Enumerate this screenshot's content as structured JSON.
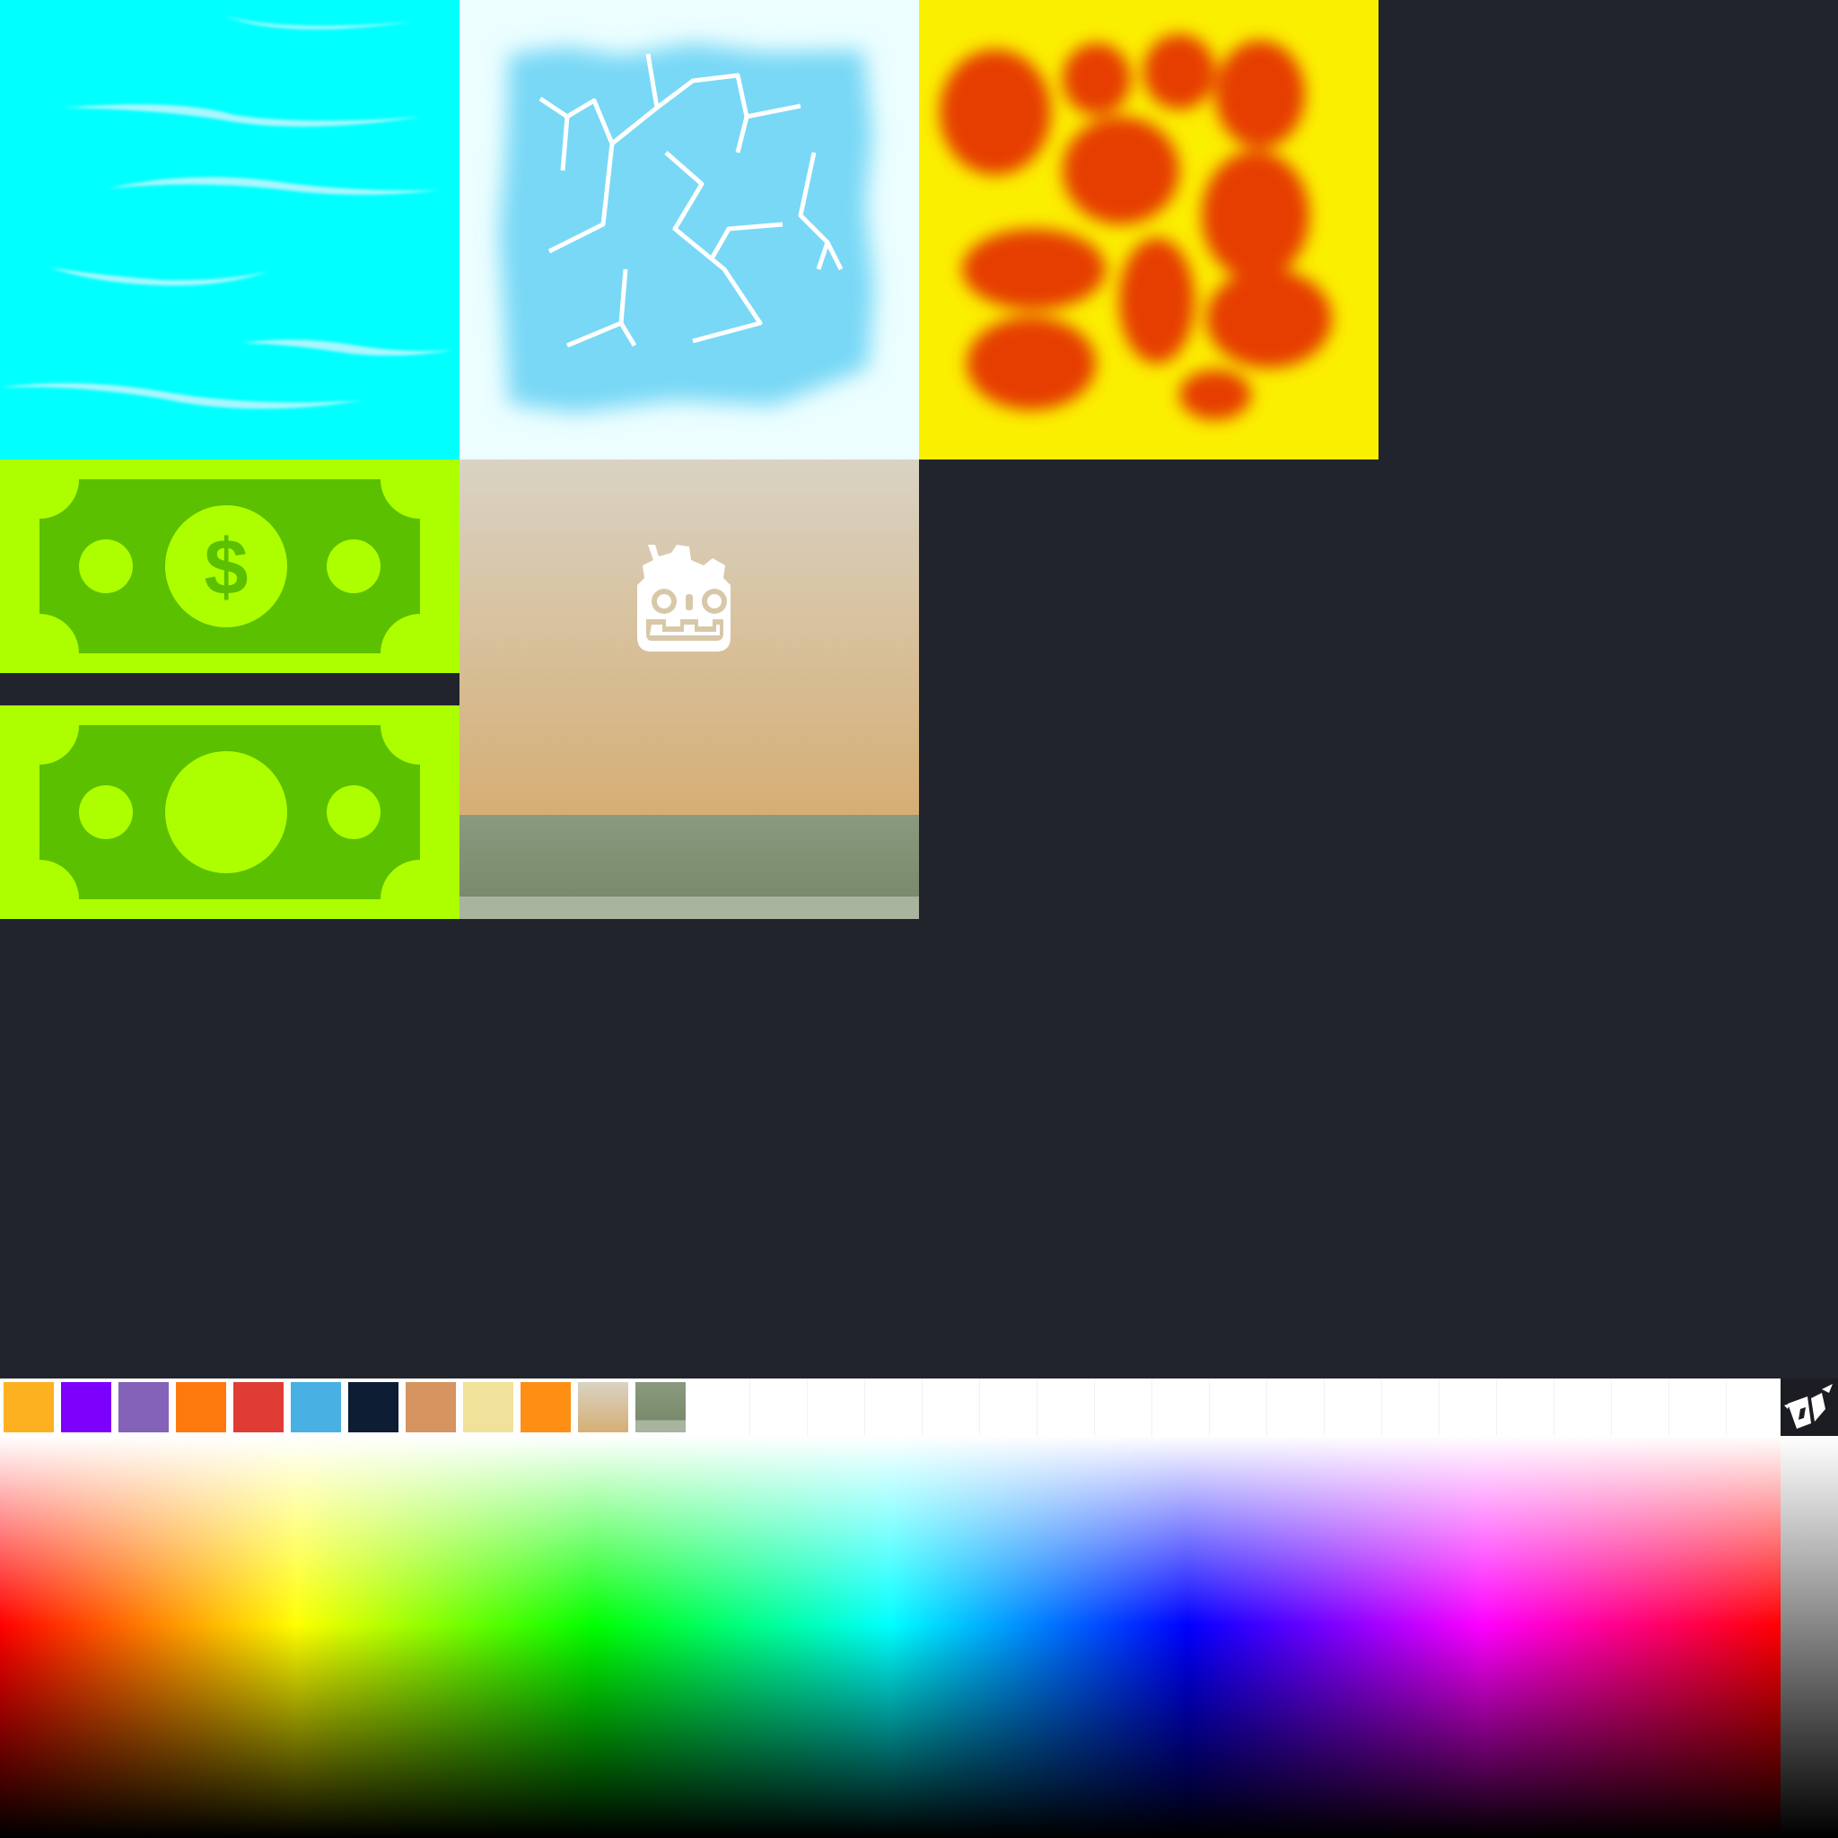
{
  "textures": [
    {
      "name": "water",
      "colors": {
        "base": "#00ffff",
        "wave": "#aaf6ff"
      }
    },
    {
      "name": "ice",
      "colors": {
        "base": "#ecfeff",
        "ice": "#78d8f6",
        "crack": "#ffffff"
      }
    },
    {
      "name": "lava",
      "colors": {
        "base": "#fbef00",
        "blob": "#e63d05"
      }
    },
    {
      "name": "banknote-dollar",
      "symbol": "$",
      "colors": {
        "bg": "#adff00",
        "note": "#5ac000"
      }
    },
    {
      "name": "banknote-blank",
      "colors": {
        "bg": "#adff00",
        "note": "#5ac000"
      }
    },
    {
      "name": "godot-sky",
      "icon": "godot-robot-icon",
      "colors": {
        "sky_top": "#d9d3c4",
        "sky_bottom": "#d6ae74",
        "ground": "#7d8c6f",
        "ground_strip": "#a8b49e"
      }
    }
  ],
  "palette": {
    "swatches": [
      {
        "color": "#fdb120"
      },
      {
        "color": "#7c00fc"
      },
      {
        "color": "#8462b7"
      },
      {
        "color": "#ff7a0e"
      },
      {
        "color": "#e03c36"
      },
      {
        "color": "#48b0e2"
      },
      {
        "color": "#0d1d33"
      },
      {
        "color": "#d59460"
      },
      {
        "color": "#f0e29a"
      },
      {
        "color": "#fe8f14"
      },
      {
        "color": "sky-gradient"
      },
      {
        "color": "ground-gradient"
      }
    ],
    "empty_slots": 19,
    "logo_icon": "origami-bird-logo-icon"
  },
  "spectrum": {
    "type": "hue-saturation-lightness"
  },
  "gray_ramp": {
    "from": "#ffffff",
    "to": "#000000"
  }
}
